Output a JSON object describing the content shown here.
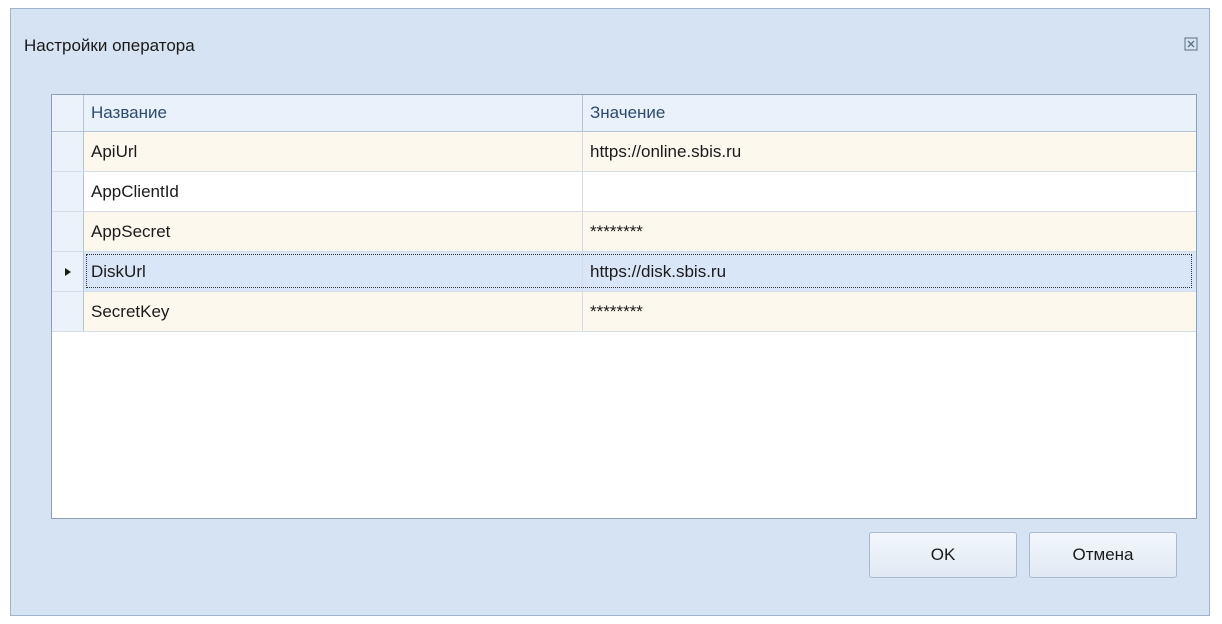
{
  "window": {
    "title": "Настройки оператора"
  },
  "grid": {
    "columns": [
      "Название",
      "Значение"
    ],
    "rows": [
      {
        "name": "ApiUrl",
        "value": "https://online.sbis.ru"
      },
      {
        "name": "AppClientId",
        "value": ""
      },
      {
        "name": "AppSecret",
        "value": "********"
      },
      {
        "name": "DiskUrl",
        "value": "https://disk.sbis.ru"
      },
      {
        "name": "SecretKey",
        "value": "********"
      }
    ],
    "selected_row": 3
  },
  "buttons": {
    "ok_label": "OK",
    "cancel_label": "Отмена"
  },
  "icons": {
    "close": "close-icon",
    "row_indicator": "row-indicator-arrow-icon"
  },
  "colors": {
    "window_bg": "#d5e3f3",
    "header_bg": "#e9f1fb",
    "row_alt_bg": "#fdf8ee",
    "row_selected_bg": "#d8e6f8"
  }
}
